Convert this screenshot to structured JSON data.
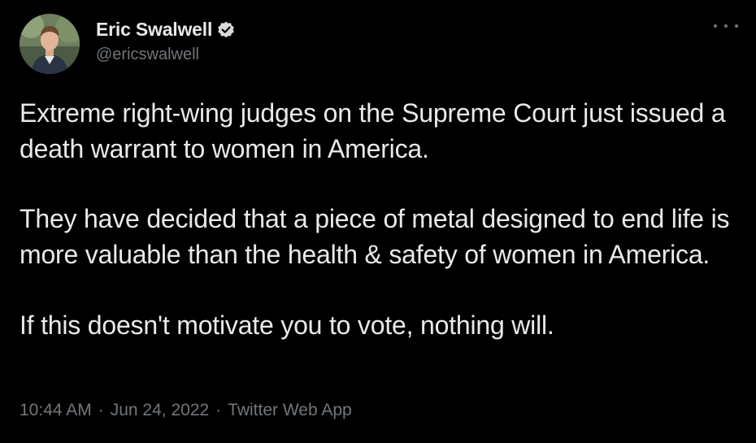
{
  "author": {
    "display_name": "Eric Swalwell",
    "handle": "@ericswalwell",
    "verified_icon": "verified-badge-icon",
    "avatar": "profile-photo"
  },
  "menu": {
    "icon": "more-options-icon"
  },
  "tweet": {
    "paragraphs": [
      "Extreme right-wing judges on the Supreme Court just issued a death warrant to women in America.",
      "They have decided that a piece of metal designed to end life is more valuable than the health & safety of women in America.",
      "If this doesn't motivate you to vote, nothing will."
    ]
  },
  "meta": {
    "time": "10:44 AM",
    "separator": "·",
    "date": "Jun 24, 2022",
    "source": "Twitter Web App"
  },
  "colors": {
    "background": "#000000",
    "primary_text": "#e7e9ea",
    "secondary_text": "#71767b",
    "verified": "#d9d9d9"
  }
}
